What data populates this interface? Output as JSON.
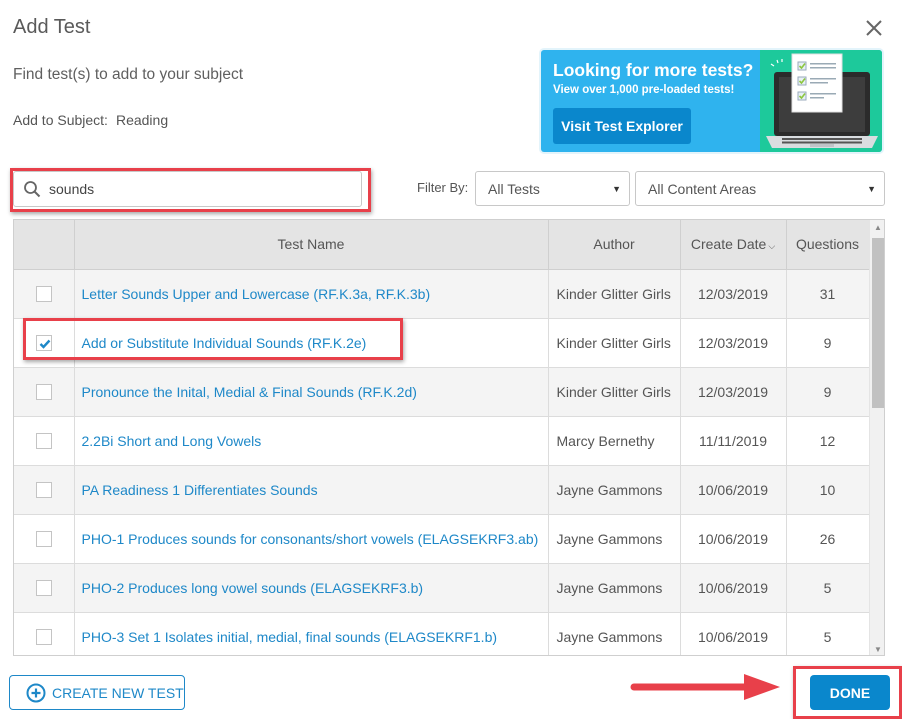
{
  "dialog": {
    "title": "Add Test",
    "subtitle": "Find test(s) to add to your subject",
    "subject_label": "Add to Subject:",
    "subject_value": "Reading"
  },
  "banner": {
    "heading": "Looking for more tests?",
    "subheading": "View over 1,000 pre-loaded tests!",
    "button_label": "Visit Test Explorer"
  },
  "search": {
    "value": "sounds",
    "placeholder": ""
  },
  "filters": {
    "label": "Filter By:",
    "test_type": "All Tests",
    "content_area": "All Content Areas"
  },
  "table": {
    "columns": [
      "",
      "Test Name",
      "Author",
      "Create Date",
      "Questions"
    ],
    "sort_column": "Create Date",
    "sort_direction": "descending",
    "rows": [
      {
        "checked": false,
        "name": "Letter Sounds Upper and Lowercase (RF.K.3a, RF.K.3b)",
        "author": "Kinder Glitter Girls",
        "date": "12/03/2019",
        "questions": "31"
      },
      {
        "checked": true,
        "name": "Add or Substitute Individual Sounds (RF.K.2e)",
        "author": "Kinder Glitter Girls",
        "date": "12/03/2019",
        "questions": "9"
      },
      {
        "checked": false,
        "name": "Pronounce the Inital, Medial & Final Sounds (RF.K.2d)",
        "author": "Kinder Glitter Girls",
        "date": "12/03/2019",
        "questions": "9"
      },
      {
        "checked": false,
        "name": "2.2Bi Short and Long Vowels",
        "author": "Marcy Bernethy",
        "date": "11/11/2019",
        "questions": "12"
      },
      {
        "checked": false,
        "name": "PA Readiness 1 Differentiates Sounds",
        "author": "Jayne Gammons",
        "date": "10/06/2019",
        "questions": "10"
      },
      {
        "checked": false,
        "name": "PHO-1 Produces sounds for consonants/short vowels (ELAGSEKRF3.ab)",
        "author": "Jayne Gammons",
        "date": "10/06/2019",
        "questions": "26"
      },
      {
        "checked": false,
        "name": "PHO-2 Produces long vowel sounds (ELAGSEKRF3.b)",
        "author": "Jayne Gammons",
        "date": "10/06/2019",
        "questions": "5"
      },
      {
        "checked": false,
        "name": "PHO-3 Set 1 Isolates initial, medial, final sounds (ELAGSEKRF1.b)",
        "author": "Jayne Gammons",
        "date": "10/06/2019",
        "questions": "5"
      }
    ]
  },
  "footer": {
    "create_label": "CREATE NEW TEST",
    "done_label": "DONE"
  },
  "colors": {
    "accent": "#0a87cc",
    "link": "#1e88c8",
    "banner_bg": "#2fb3ee",
    "banner_art_bg": "#1dc99b",
    "annotation": "#e8404a"
  }
}
